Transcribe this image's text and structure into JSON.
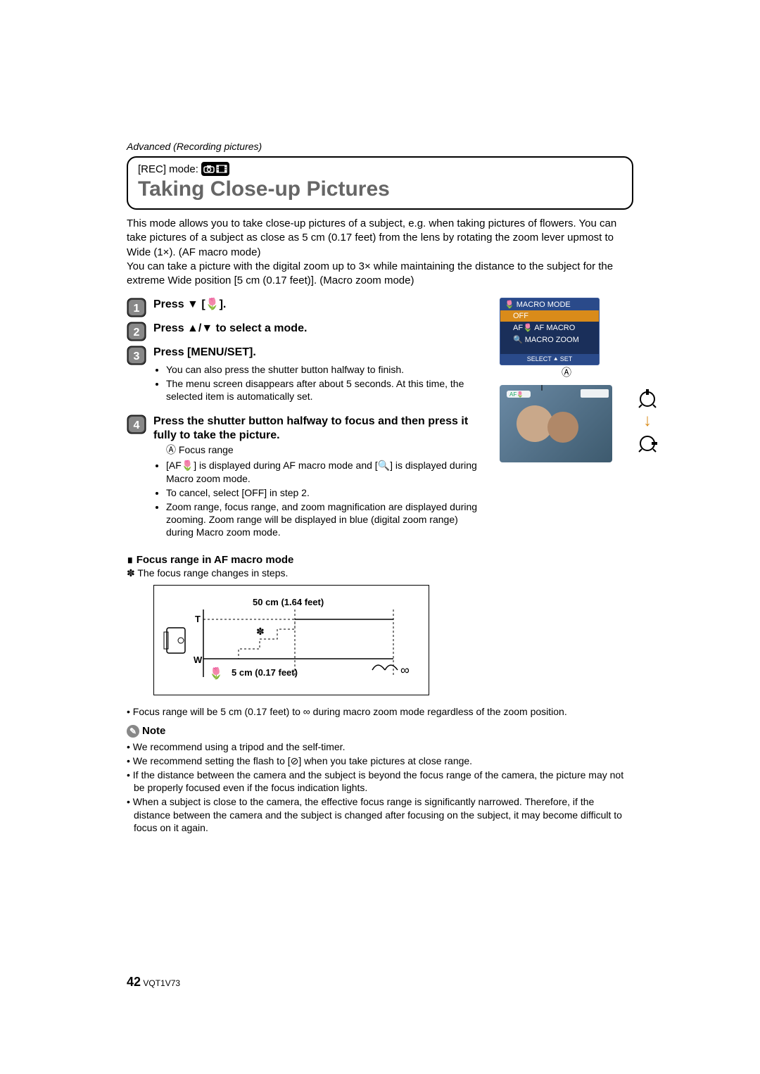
{
  "header": {
    "section": "Advanced (Recording pictures)",
    "rec_mode_label": "[REC] mode:",
    "title": "Taking Close-up Pictures"
  },
  "intro": {
    "p1": "This mode allows you to take close-up pictures of a subject, e.g. when taking pictures of flowers. You can take pictures of a subject as close as 5 cm (0.17 feet) from the lens by rotating the zoom lever upmost to Wide (1×). (AF macro mode)",
    "p2": "You can take a picture with the digital zoom up to 3× while maintaining the distance to the subject for the extreme Wide position [5 cm (0.17 feet)]. (Macro zoom mode)"
  },
  "steps": {
    "s1": "Press ▼ [🌷].",
    "s2": "Press ▲/▼ to select a mode.",
    "s3": "Press [MENU/SET].",
    "s3_b1": "You can also press the shutter button halfway to finish.",
    "s3_b2": "The menu screen disappears after about 5 seconds. At this time, the selected item is automatically set.",
    "s4": "Press the shutter button halfway to focus and then press it fully to take the picture.",
    "s4_a": "Ⓐ Focus range",
    "s4_b1": "[AF🌷] is displayed during AF macro mode and [🔍] is displayed during Macro zoom mode.",
    "s4_b2": "To cancel, select [OFF] in step 2.",
    "s4_b3": "Zoom range, focus range, and zoom magnification are displayed during zooming. Zoom range will be displayed in blue (digital zoom range) during Macro zoom mode."
  },
  "macro_menu": {
    "title": "🌷 MACRO MODE",
    "items": [
      "OFF",
      "AF🌷 AF MACRO",
      "🔍 MACRO ZOOM"
    ],
    "footer": "SELECT ⯅ SET"
  },
  "indicator_A": "Ⓐ",
  "focus_section": {
    "heading": "∎ Focus range in AF macro mode",
    "aster": "✽  The focus range changes in steps.",
    "label_top": "50 cm (1.64 feet)",
    "t": "T",
    "w": "W",
    "label_bottom": "5 cm (0.17 feet)",
    "inf": "∞"
  },
  "after_diagram": "• Focus range will be 5 cm (0.17 feet) to ∞ during macro zoom mode regardless of the zoom position.",
  "note": {
    "head": "Note",
    "n1": "• We recommend using a tripod and the self-timer.",
    "n2": "• We recommend setting the flash to [⊘] when you take pictures at close range.",
    "n3": "• If the distance between the camera and the subject is beyond the focus range of the camera, the picture may not be properly focused even if the focus indication lights.",
    "n4": "• When a subject is close to the camera, the effective focus range is significantly narrowed. Therefore, if the distance between the camera and the subject is changed after focusing on the subject, it may become difficult to focus on it again."
  },
  "footer": {
    "page": "42",
    "code": "VQT1V73"
  }
}
